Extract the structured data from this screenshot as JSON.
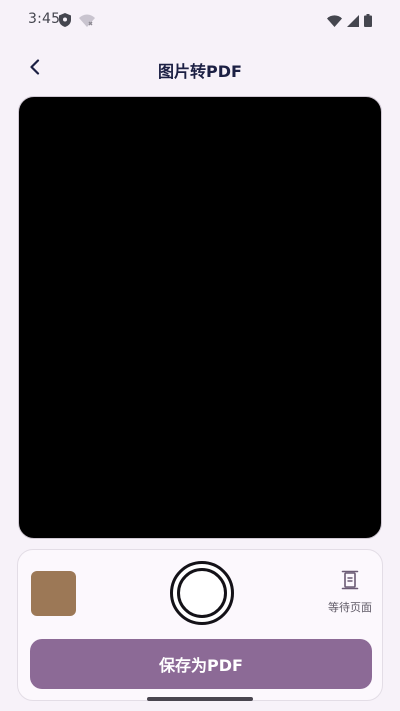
{
  "status_bar": {
    "time": "3:45",
    "left_icons": [
      "shield-icon",
      "wifi-off-icon"
    ],
    "right_icons": [
      "wifi-icon",
      "signal-icon",
      "battery-icon"
    ]
  },
  "app_bar": {
    "back_icon": "chevron-left-icon",
    "title": "图片转PDF"
  },
  "camera": {
    "preview_color": "#000000"
  },
  "controls": {
    "thumbnail_color": "#9c7856",
    "pending_icon": "page-stack-icon",
    "pending_label": "等待页面",
    "save_label": "保存为PDF"
  },
  "colors": {
    "accent": "#8c6a96",
    "background": "#f7f2f9"
  }
}
